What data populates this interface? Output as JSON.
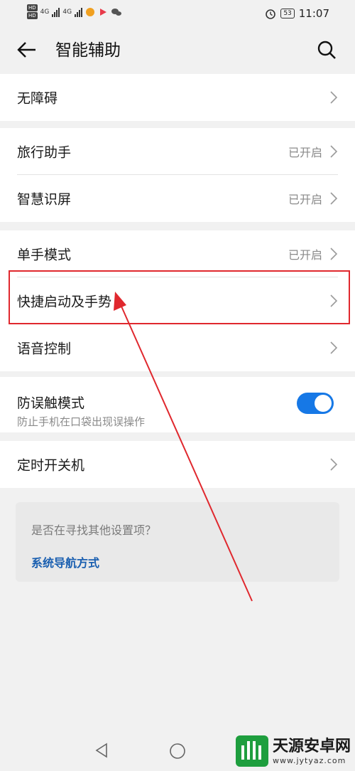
{
  "status_bar": {
    "hd_badges": [
      "HD",
      "HD"
    ],
    "network": [
      "4G",
      "4G"
    ],
    "battery": "53",
    "time": "11:07"
  },
  "header": {
    "title": "智能辅助"
  },
  "sections": [
    {
      "rows": [
        {
          "label": "无障碍",
          "status": ""
        }
      ]
    },
    {
      "rows": [
        {
          "label": "旅行助手",
          "status": "已开启"
        },
        {
          "label": "智慧识屏",
          "status": "已开启"
        }
      ]
    },
    {
      "rows": [
        {
          "label": "单手模式",
          "status": "已开启"
        },
        {
          "label": "快捷启动及手势",
          "status": ""
        },
        {
          "label": "语音控制",
          "status": ""
        }
      ]
    },
    {
      "rows": [
        {
          "label": "防误触模式",
          "sublabel": "防止手机在口袋出现误操作",
          "toggle_on": true
        }
      ]
    },
    {
      "rows": [
        {
          "label": "定时开关机",
          "status": ""
        }
      ]
    }
  ],
  "hint_box": {
    "question": "是否在寻找其他设置项？",
    "link": "系统导航方式"
  },
  "watermark": {
    "name": "天源安卓网",
    "url": "www.jytyaz.com"
  },
  "colors": {
    "accent": "#1678e6",
    "annotation": "#e0282e",
    "link": "#1a5fb0"
  }
}
